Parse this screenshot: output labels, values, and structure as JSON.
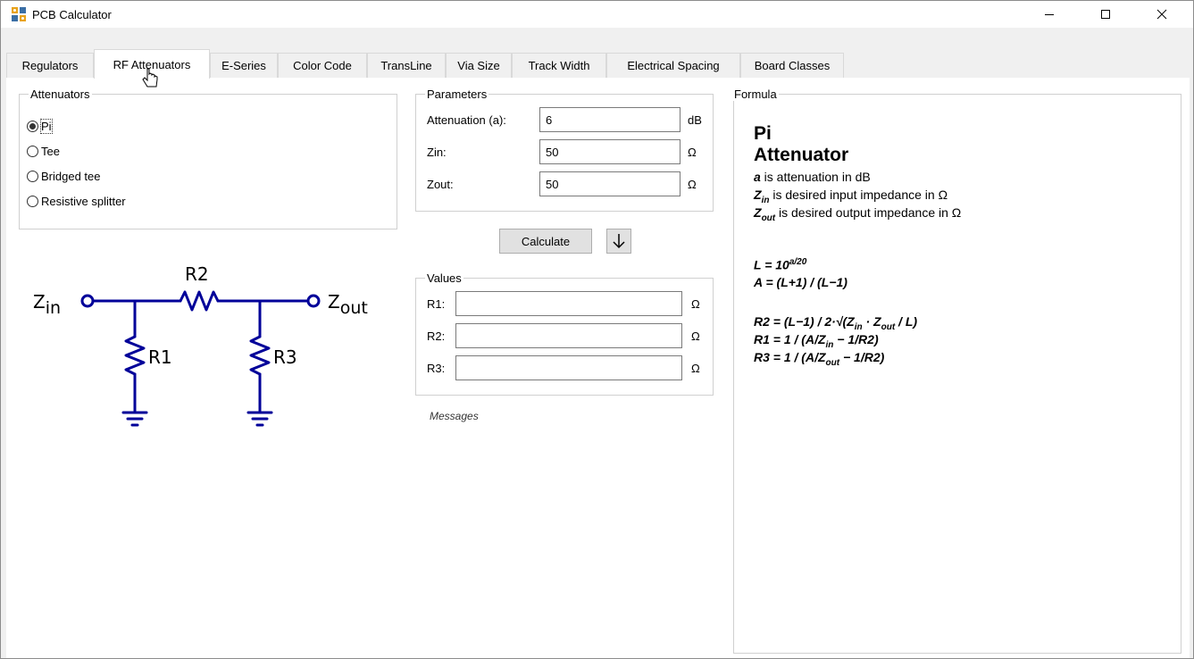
{
  "window": {
    "title": "PCB Calculator"
  },
  "tabs": [
    {
      "label": "Regulators"
    },
    {
      "label": "RF Attenuators"
    },
    {
      "label": "E-Series"
    },
    {
      "label": "Color Code"
    },
    {
      "label": "TransLine"
    },
    {
      "label": "Via Size"
    },
    {
      "label": "Track Width"
    },
    {
      "label": "Electrical Spacing"
    },
    {
      "label": "Board Classes"
    }
  ],
  "attenuators": {
    "title": "Attenuators",
    "options": [
      {
        "label": "Pi",
        "checked": true
      },
      {
        "label": "Tee",
        "checked": false
      },
      {
        "label": "Bridged tee",
        "checked": false
      },
      {
        "label": "Resistive splitter",
        "checked": false
      }
    ]
  },
  "parameters": {
    "title": "Parameters",
    "attenuation": {
      "label": "Attenuation (a):",
      "value": "6",
      "unit": "dB"
    },
    "zin": {
      "label": "Zin:",
      "value": "50",
      "unit": "Ω"
    },
    "zout": {
      "label": "Zout:",
      "value": "50",
      "unit": "Ω"
    }
  },
  "actions": {
    "calculate": "Calculate",
    "arrow_icon": "down-arrow-icon"
  },
  "values": {
    "title": "Values",
    "r1": {
      "label": "R1:",
      "value": "",
      "unit": "Ω"
    },
    "r2": {
      "label": "R2:",
      "value": "",
      "unit": "Ω"
    },
    "r3": {
      "label": "R3:",
      "value": "",
      "unit": "Ω"
    }
  },
  "messages": "Messages",
  "schematic": {
    "zin_label": "Z",
    "zin_sub": "in",
    "zout_label": "Z",
    "zout_sub": "out",
    "r1": "R1",
    "r2": "R2",
    "r3": "R3",
    "color": "#000099"
  },
  "formula": {
    "title": "Formula",
    "heading": "Pi Attenuator",
    "a_sym": "a",
    "a_desc": " is attenuation in dB",
    "zin_sym": "Z",
    "zin_sub": "in",
    "zin_desc": " is desired input impedance in Ω",
    "zout_sym": "Z",
    "zout_sub": "out",
    "zout_desc": " is desired output impedance in Ω",
    "l_eq": "L = 10",
    "l_exp": "a/20",
    "a_eq": "A = (L+1) / (L−1)",
    "r2_eq_a": "R2 = (L−1) / 2·√(Z",
    "r2_sub1": "in",
    "r2_eq_b": " · Z",
    "r2_sub2": "out",
    "r2_eq_c": " / L)",
    "r1_eq_a": "R1 = 1 / (A/Z",
    "r1_sub": "in",
    "r1_eq_b": " − 1/R2)",
    "r3_eq_a": "R3 = 1 / (A/Z",
    "r3_sub": "out",
    "r3_eq_b": " − 1/R2)"
  }
}
